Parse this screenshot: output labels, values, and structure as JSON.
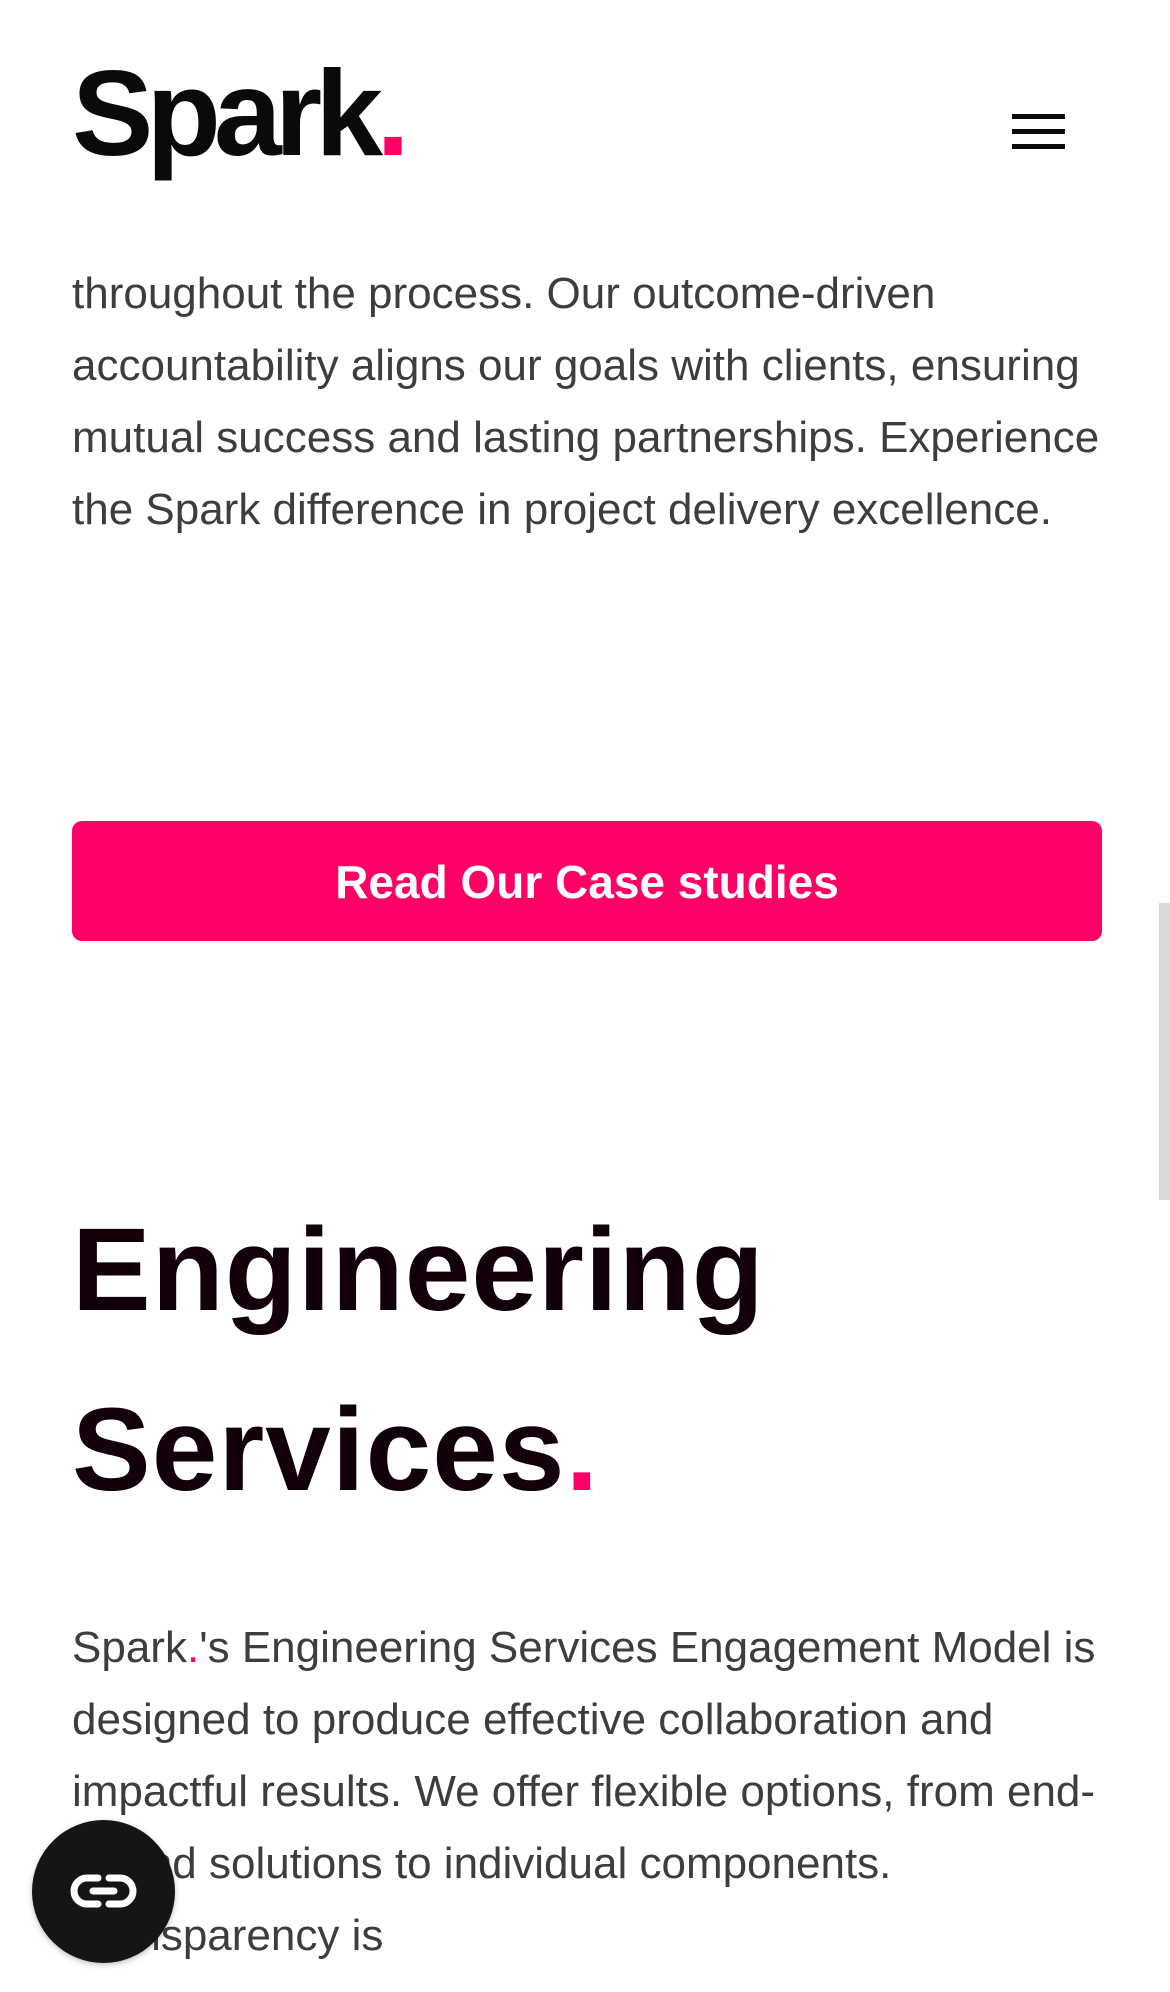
{
  "header": {
    "logo_text": "Spark",
    "logo_dot": ".",
    "menu_label": "Menu"
  },
  "intro": {
    "paragraph": "throughout the process. Our outcome-driven accountability aligns our goals with clients, ensuring mutual success and lasting partnerships. Experience the Spark difference in project delivery excellence."
  },
  "cta": {
    "label": "Read Our Case studies"
  },
  "engineering": {
    "title_line1": "Engineering",
    "title_line2": "Services",
    "title_dot": ".",
    "brand": "Spark",
    "brand_dot": ".",
    "paragraph": "'s Engineering Services Engagement Model is designed to produce effective collaboration and impactful results. We offer flexible options, from end-to-end solutions to individual components. Transparency is"
  },
  "floating_button": {
    "icon": "link-icon"
  },
  "colors": {
    "accent": "#ff0066",
    "text": "#3d3d3d",
    "heading": "#12000a",
    "floating_button_bg": "#151515"
  }
}
